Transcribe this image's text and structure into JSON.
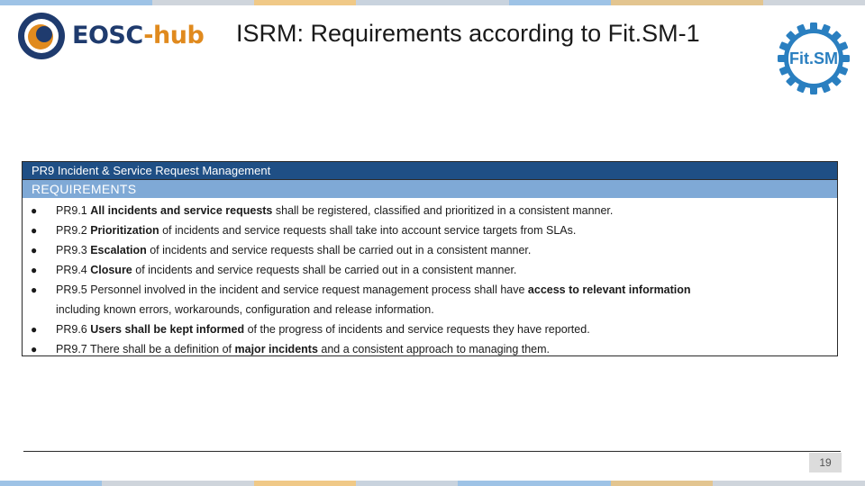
{
  "header": {
    "logo_left": {
      "text_main": "EOSC",
      "text_dash": "-",
      "text_sub": "hub"
    },
    "title": "ISRM: Requirements according to Fit.SM-1",
    "logo_right": {
      "text": "Fit.SM"
    }
  },
  "colors": {
    "header_bar": "#1f4f85",
    "subheader_bar": "#7fa9d6",
    "eosc_blue": "#1f3b6e",
    "eosc_orange": "#e08a1e",
    "fitsm_blue": "#2a7fc0"
  },
  "requirements": {
    "heading": "PR9 Incident & Service Request Management",
    "subheading": "REQUIREMENTS",
    "items": [
      {
        "lines": [
          [
            {
              "t": "PR9.1 ",
              "b": false
            },
            {
              "t": "All incidents and service requests",
              "b": true
            },
            {
              "t": " shall be registered, classified and prioritized in a consistent manner.",
              "b": false
            }
          ]
        ]
      },
      {
        "lines": [
          [
            {
              "t": "PR9.2 ",
              "b": false
            },
            {
              "t": "Prioritization",
              "b": true
            },
            {
              "t": " of incidents and service requests shall take into account service targets from SLAs.",
              "b": false
            }
          ]
        ]
      },
      {
        "lines": [
          [
            {
              "t": "PR9.3 ",
              "b": false
            },
            {
              "t": "Escalation",
              "b": true
            },
            {
              "t": " of incidents and service requests shall be carried out in a consistent manner.",
              "b": false
            }
          ]
        ]
      },
      {
        "lines": [
          [
            {
              "t": "PR9.4 ",
              "b": false
            },
            {
              "t": "Closure",
              "b": true
            },
            {
              "t": " of incidents and service requests shall be carried out in a consistent manner.",
              "b": false
            }
          ]
        ]
      },
      {
        "lines": [
          [
            {
              "t": "PR9.5 Personnel involved in the incident and service request management process shall have ",
              "b": false
            },
            {
              "t": "access to relevant information",
              "b": true
            }
          ],
          [
            {
              "t": "including known errors, workarounds, configuration and release information.",
              "b": false
            }
          ]
        ]
      },
      {
        "lines": [
          [
            {
              "t": "PR9.6 ",
              "b": false
            },
            {
              "t": "Users shall be kept informed",
              "b": true
            },
            {
              "t": " of the progress of incidents and service requests they have reported.",
              "b": false
            }
          ]
        ]
      },
      {
        "lines": [
          [
            {
              "t": "PR9.7 There shall be a definition of ",
              "b": false
            },
            {
              "t": "major incidents",
              "b": true
            },
            {
              "t": " and a consistent approach to managing them.",
              "b": false
            }
          ]
        ]
      }
    ]
  },
  "footer": {
    "page_number": "19"
  },
  "decor": {
    "strip_colors": [
      "#9ec3e6",
      "#cfd5dc",
      "#f0c987",
      "#c9d3de",
      "#9ec3e6",
      "#e3c590",
      "#cfd5dc"
    ]
  }
}
